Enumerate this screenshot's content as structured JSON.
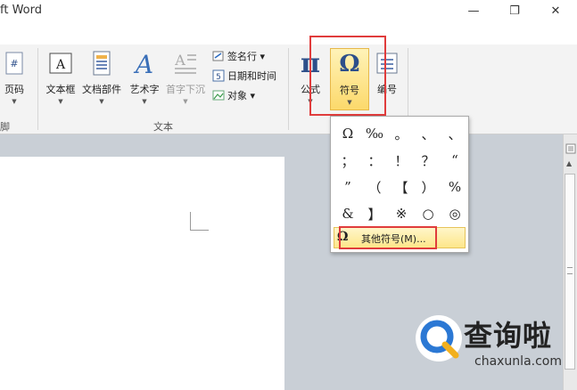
{
  "window": {
    "title": "ft Word",
    "controls": [
      "—",
      "❐",
      "✕"
    ]
  },
  "ribbon": {
    "partial_left_label": "页码",
    "partial_group_label": "脚",
    "text_group": {
      "label": "文本",
      "buttons": [
        {
          "label": "文本框",
          "icon": "text-box-icon"
        },
        {
          "label": "文档部件",
          "icon": "document-parts-icon"
        },
        {
          "label": "艺术字",
          "icon": "wordart-icon"
        },
        {
          "label": "首字下沉",
          "icon": "drop-cap-icon",
          "disabled": true
        }
      ],
      "small_buttons": [
        {
          "label": "签名行 ▾",
          "icon": "signature-line-icon"
        },
        {
          "label": "日期和时间",
          "icon": "date-time-icon"
        },
        {
          "label": "对象 ▾",
          "icon": "object-icon"
        }
      ]
    },
    "symbols_group": {
      "buttons": [
        {
          "label": "公式",
          "icon": "equation-icon",
          "glyph": "π"
        },
        {
          "label": "符号",
          "icon": "symbol-icon",
          "glyph": "Ω"
        },
        {
          "label": "编号",
          "icon": "number-icon"
        }
      ]
    }
  },
  "symbol_dropdown": {
    "symbols": [
      "Ω",
      "‰",
      "。",
      "、",
      "、",
      "；",
      "：",
      "！",
      "？",
      "“",
      "”",
      "（",
      "【",
      "）",
      "%",
      "&",
      "】",
      "※",
      "○",
      "◎"
    ],
    "more_label": "其他符号(M)...",
    "more_icon_glyph": "Ω"
  },
  "watermark": {
    "text": "查询啦",
    "sub": "chaxunla.com"
  },
  "colors": {
    "highlight": "#e03c3c",
    "ribbon_bg": "#f3f3f3",
    "doc_bg": "#c9cfd6",
    "hover": "#fde68a",
    "help": "#2d6cc0"
  }
}
